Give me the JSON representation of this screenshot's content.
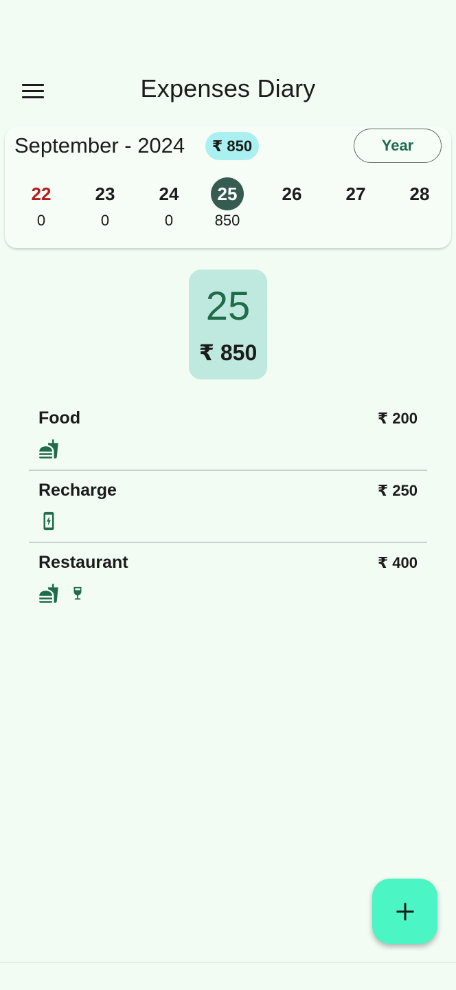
{
  "app": {
    "title": "Expenses Diary",
    "menu_icon": "hamburger-menu-icon"
  },
  "month_card": {
    "title": "September - 2024",
    "total": "₹ 850",
    "year_button": "Year",
    "days": [
      {
        "day": "22",
        "amount": "0",
        "sunday": true
      },
      {
        "day": "23",
        "amount": "0"
      },
      {
        "day": "24",
        "amount": "0"
      },
      {
        "day": "25",
        "amount": "850",
        "selected": true
      },
      {
        "day": "26",
        "amount": ""
      },
      {
        "day": "27",
        "amount": ""
      },
      {
        "day": "28",
        "amount": ""
      }
    ]
  },
  "selected_day": {
    "day": "25",
    "total": "₹ 850"
  },
  "expenses": [
    {
      "name": "Food",
      "amount": "₹ 200",
      "icons": [
        "fastfood-icon"
      ]
    },
    {
      "name": "Recharge",
      "amount": "₹ 250",
      "icons": [
        "mobile-charging-icon"
      ]
    },
    {
      "name": "Restaurant",
      "amount": "₹ 400",
      "icons": [
        "fastfood-icon",
        "wine-glass-icon"
      ]
    }
  ],
  "fab": {
    "icon": "plus-icon"
  },
  "colors": {
    "background": "#f2fcf3",
    "accent": "#1f6b4a",
    "selected_day": "#365c52",
    "sunday": "#b71c1c",
    "badge": "#aaf0f0",
    "summary_card": "#bfe9df",
    "fab": "#4cf5c4"
  }
}
